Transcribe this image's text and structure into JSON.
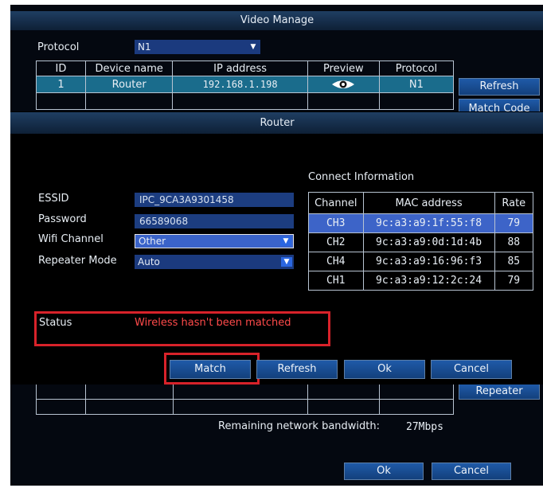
{
  "video_manage": {
    "title": "Video Manage",
    "protocol_label": "Protocol",
    "protocol_value": "N1",
    "table_headers": [
      "ID",
      "Device name",
      "IP address",
      "Preview",
      "Protocol"
    ],
    "rows": [
      {
        "id": "1",
        "device": "Router",
        "ip": "192.168.1.198",
        "preview": "eye-icon",
        "protocol": "N1"
      }
    ],
    "refresh_label": "Refresh",
    "match_code_label": "Match Code",
    "repeater_label": "Repeater",
    "bandwidth_label": "Remaining network bandwidth:",
    "bandwidth_value": "27Mbps",
    "ok_label": "Ok",
    "cancel_label": "Cancel"
  },
  "router": {
    "title": "Router",
    "essid_label": "ESSID",
    "essid_value": "IPC_9CA3A9301458",
    "password_label": "Password",
    "password_value": "66589068",
    "wifi_channel_label": "Wifi Channel",
    "wifi_channel_value": "Other",
    "repeater_mode_label": "Repeater Mode",
    "repeater_mode_value": "Auto",
    "connect_info_label": "Connect Information",
    "connect_headers": [
      "Channel",
      "MAC address",
      "Rate"
    ],
    "connect_rows": [
      {
        "channel": "CH3",
        "mac": "9c:a3:a9:1f:55:f8",
        "rate": "79"
      },
      {
        "channel": "CH2",
        "mac": "9c:a3:a9:0d:1d:4b",
        "rate": "88"
      },
      {
        "channel": "CH4",
        "mac": "9c:a3:a9:16:96:f3",
        "rate": "85"
      },
      {
        "channel": "CH1",
        "mac": "9c:a3:a9:12:2c:24",
        "rate": "79"
      }
    ],
    "status_label": "Status",
    "status_value": "Wireless hasn't been matched",
    "match_label": "Match",
    "refresh_label": "Refresh",
    "ok_label": "Ok",
    "cancel_label": "Cancel"
  },
  "colors": {
    "highlight_box": "#d8222a",
    "status_text": "#ff4a4a",
    "selected_row": "#1a6c8c",
    "selected_channel_row": "#3d64c8"
  }
}
